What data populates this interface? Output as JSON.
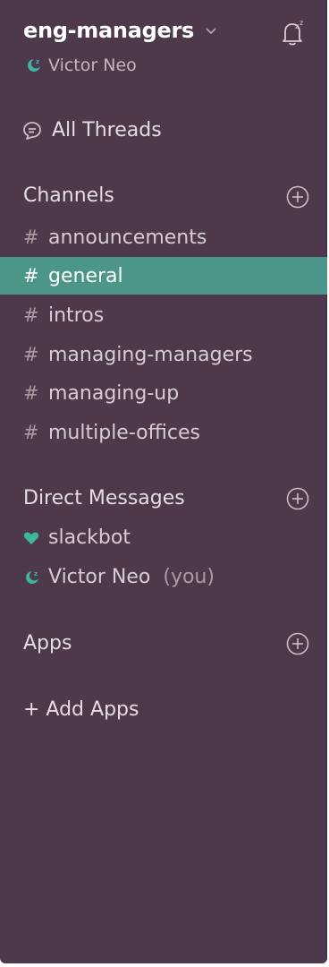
{
  "team": {
    "name": "eng-managers"
  },
  "user": {
    "name": "Victor Neo"
  },
  "threads": {
    "label": "All Threads"
  },
  "channels": {
    "title": "Channels",
    "items": [
      {
        "name": "announcements",
        "active": false
      },
      {
        "name": "general",
        "active": true
      },
      {
        "name": "intros",
        "active": false
      },
      {
        "name": "managing-managers",
        "active": false
      },
      {
        "name": "managing-up",
        "active": false
      },
      {
        "name": "multiple-offices",
        "active": false
      }
    ]
  },
  "direct_messages": {
    "title": "Direct Messages",
    "items": [
      {
        "name": "slackbot",
        "suffix": ""
      },
      {
        "name": "Victor Neo",
        "suffix": "(you)"
      }
    ]
  },
  "apps": {
    "title": "Apps",
    "add_label": "+ Add Apps"
  },
  "colors": {
    "sidebar_bg": "#4d394b",
    "active_channel_bg": "#4c9689",
    "presence_teal": "#3fb6a0"
  },
  "icons": {
    "team_menu": "chevron-down-icon",
    "notifications": "bell-snooze-icon",
    "threads": "threads-icon",
    "add": "plus-circle-icon",
    "status_away": "moon-zz-icon",
    "slackbot": "heart-icon"
  }
}
